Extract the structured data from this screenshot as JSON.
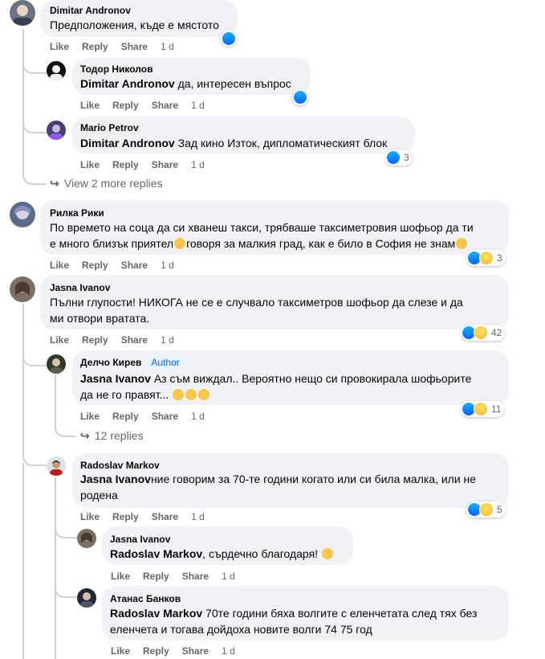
{
  "comments": [
    {
      "name": "Dimitar Andronov",
      "text": "Предположения, къде е мястото",
      "actions": {
        "like": "Like",
        "reply": "Reply",
        "share": "Share",
        "time": "1 d"
      },
      "reaction_count": ""
    },
    {
      "name": "Тодор Николов",
      "mention": "Dimitar Andronov",
      "text": " да, интересен въпрос",
      "actions": {
        "like": "Like",
        "reply": "Reply",
        "share": "Share",
        "time": "1 d"
      },
      "reaction_count": ""
    },
    {
      "name": "Mario Petrov",
      "mention": "Dimitar Andronov",
      "text": " Зад кино Изток, дипломатическият блок",
      "actions": {
        "like": "Like",
        "reply": "Reply",
        "share": "Share",
        "time": "1 d"
      },
      "reaction_count": "3"
    },
    {
      "name": "Рилка Рики",
      "text_line1": "По времето на соца да си хванеш такси, трябваше таксиметровия шофьор да ти",
      "text_line2a": "е много близък приятел",
      "text_line2b": "говоря за малкия град, как е било в София не знам",
      "actions": {
        "like": "Like",
        "reply": "Reply",
        "share": "Share",
        "time": "1 d"
      },
      "reaction_count": "3"
    },
    {
      "name": "Jasna Ivanov",
      "text_line1": "Пълни глупости! НИКОГА не се е случвало таксиметров шофьор да слезе и да",
      "text_line2": "ми отвори вратата.",
      "actions": {
        "like": "Like",
        "reply": "Reply",
        "share": "Share",
        "time": "1 d"
      },
      "reaction_count": "42"
    },
    {
      "name": "Делчо Кирев",
      "badge": "Author",
      "mention": "Jasna Ivanov",
      "text_line1": " Аз съм виждал.. Вероятно нещо си провокирала шофьорите",
      "text_line2": "да не го правят...",
      "actions": {
        "like": "Like",
        "reply": "Reply",
        "share": "Share",
        "time": "1 d"
      },
      "reaction_count": "11"
    },
    {
      "name": "Radoslav Markov",
      "mention": "Jasna Ivanov",
      "text_line1": "ние говорим за 70-те години когато или си била малка, или не",
      "text_line2": "родена",
      "actions": {
        "like": "Like",
        "reply": "Reply",
        "share": "Share",
        "time": "1 d"
      },
      "reaction_count": "5"
    },
    {
      "name": "Jasna Ivanov",
      "mention": "Radoslav Markov",
      "text": ", сърдечно благодаря!",
      "actions": {
        "like": "Like",
        "reply": "Reply",
        "share": "Share",
        "time": "1 d"
      },
      "reaction_count": ""
    },
    {
      "name": "Атанас Банков",
      "mention": "Radoslav Markov",
      "text_line1": " 70те години бяха волгите с еленчетата след тях без",
      "text_line2": "еленчета и тогава дойдоха новите волги 74 75 год",
      "actions": {
        "like": "Like",
        "reply": "Reply",
        "share": "Share",
        "time": "1 d"
      },
      "reaction_count": ""
    }
  ],
  "view_more": {
    "first": "View 2 more replies",
    "second": "12 replies"
  },
  "colors": {
    "bubble": "#f0f2f5",
    "secondary_text": "#65676b",
    "like_blue": "#0866ff",
    "thread_line": "#ced0d4"
  }
}
